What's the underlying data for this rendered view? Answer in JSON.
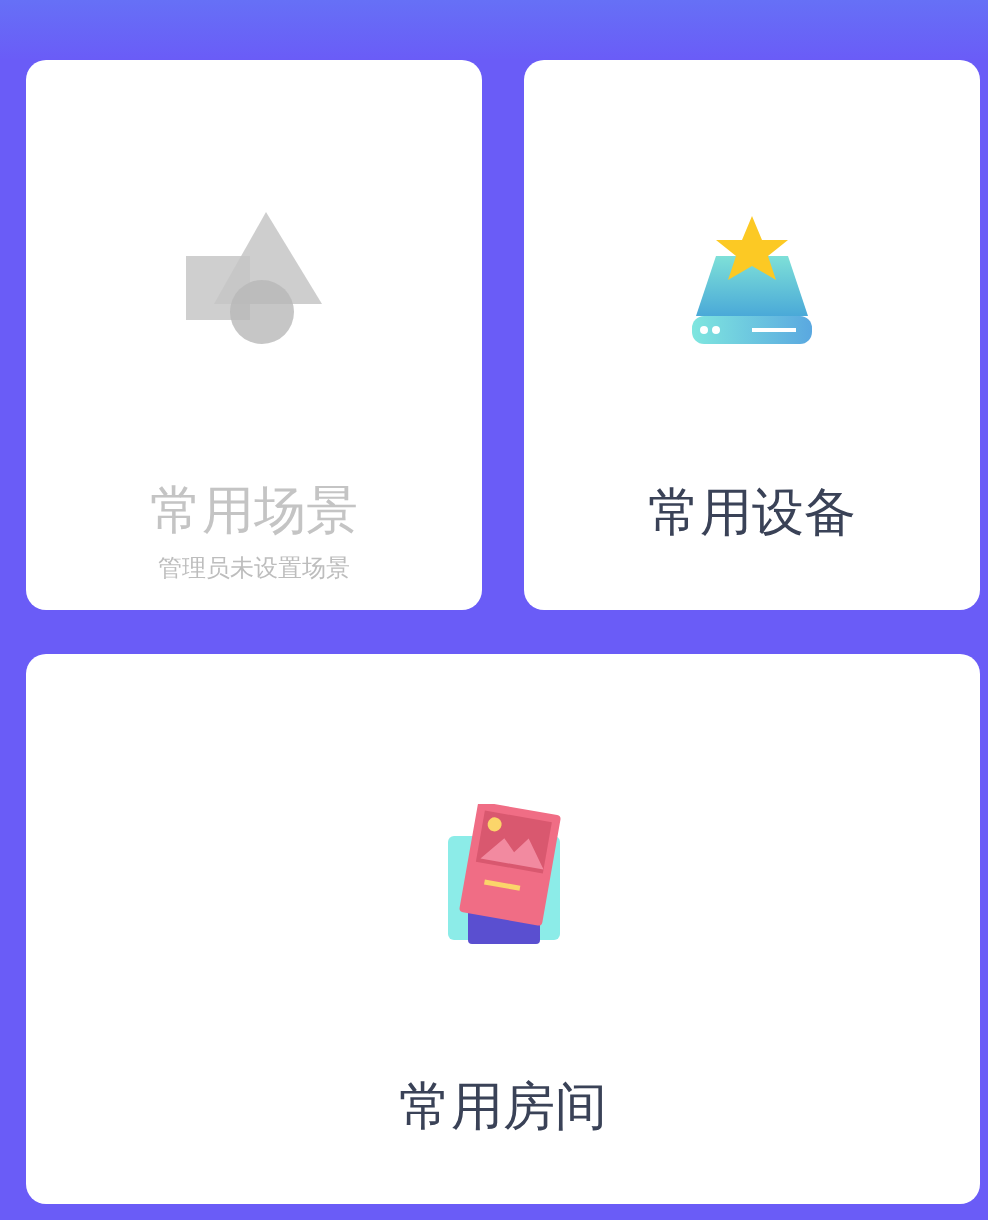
{
  "cards": [
    {
      "kind": "shapes",
      "title": "常用场景",
      "subtitle": "管理员未设置场景",
      "disabled": true
    },
    {
      "kind": "device",
      "title": "常用设备",
      "disabled": false
    },
    {
      "kind": "room",
      "title": "常用房间",
      "disabled": false
    }
  ]
}
